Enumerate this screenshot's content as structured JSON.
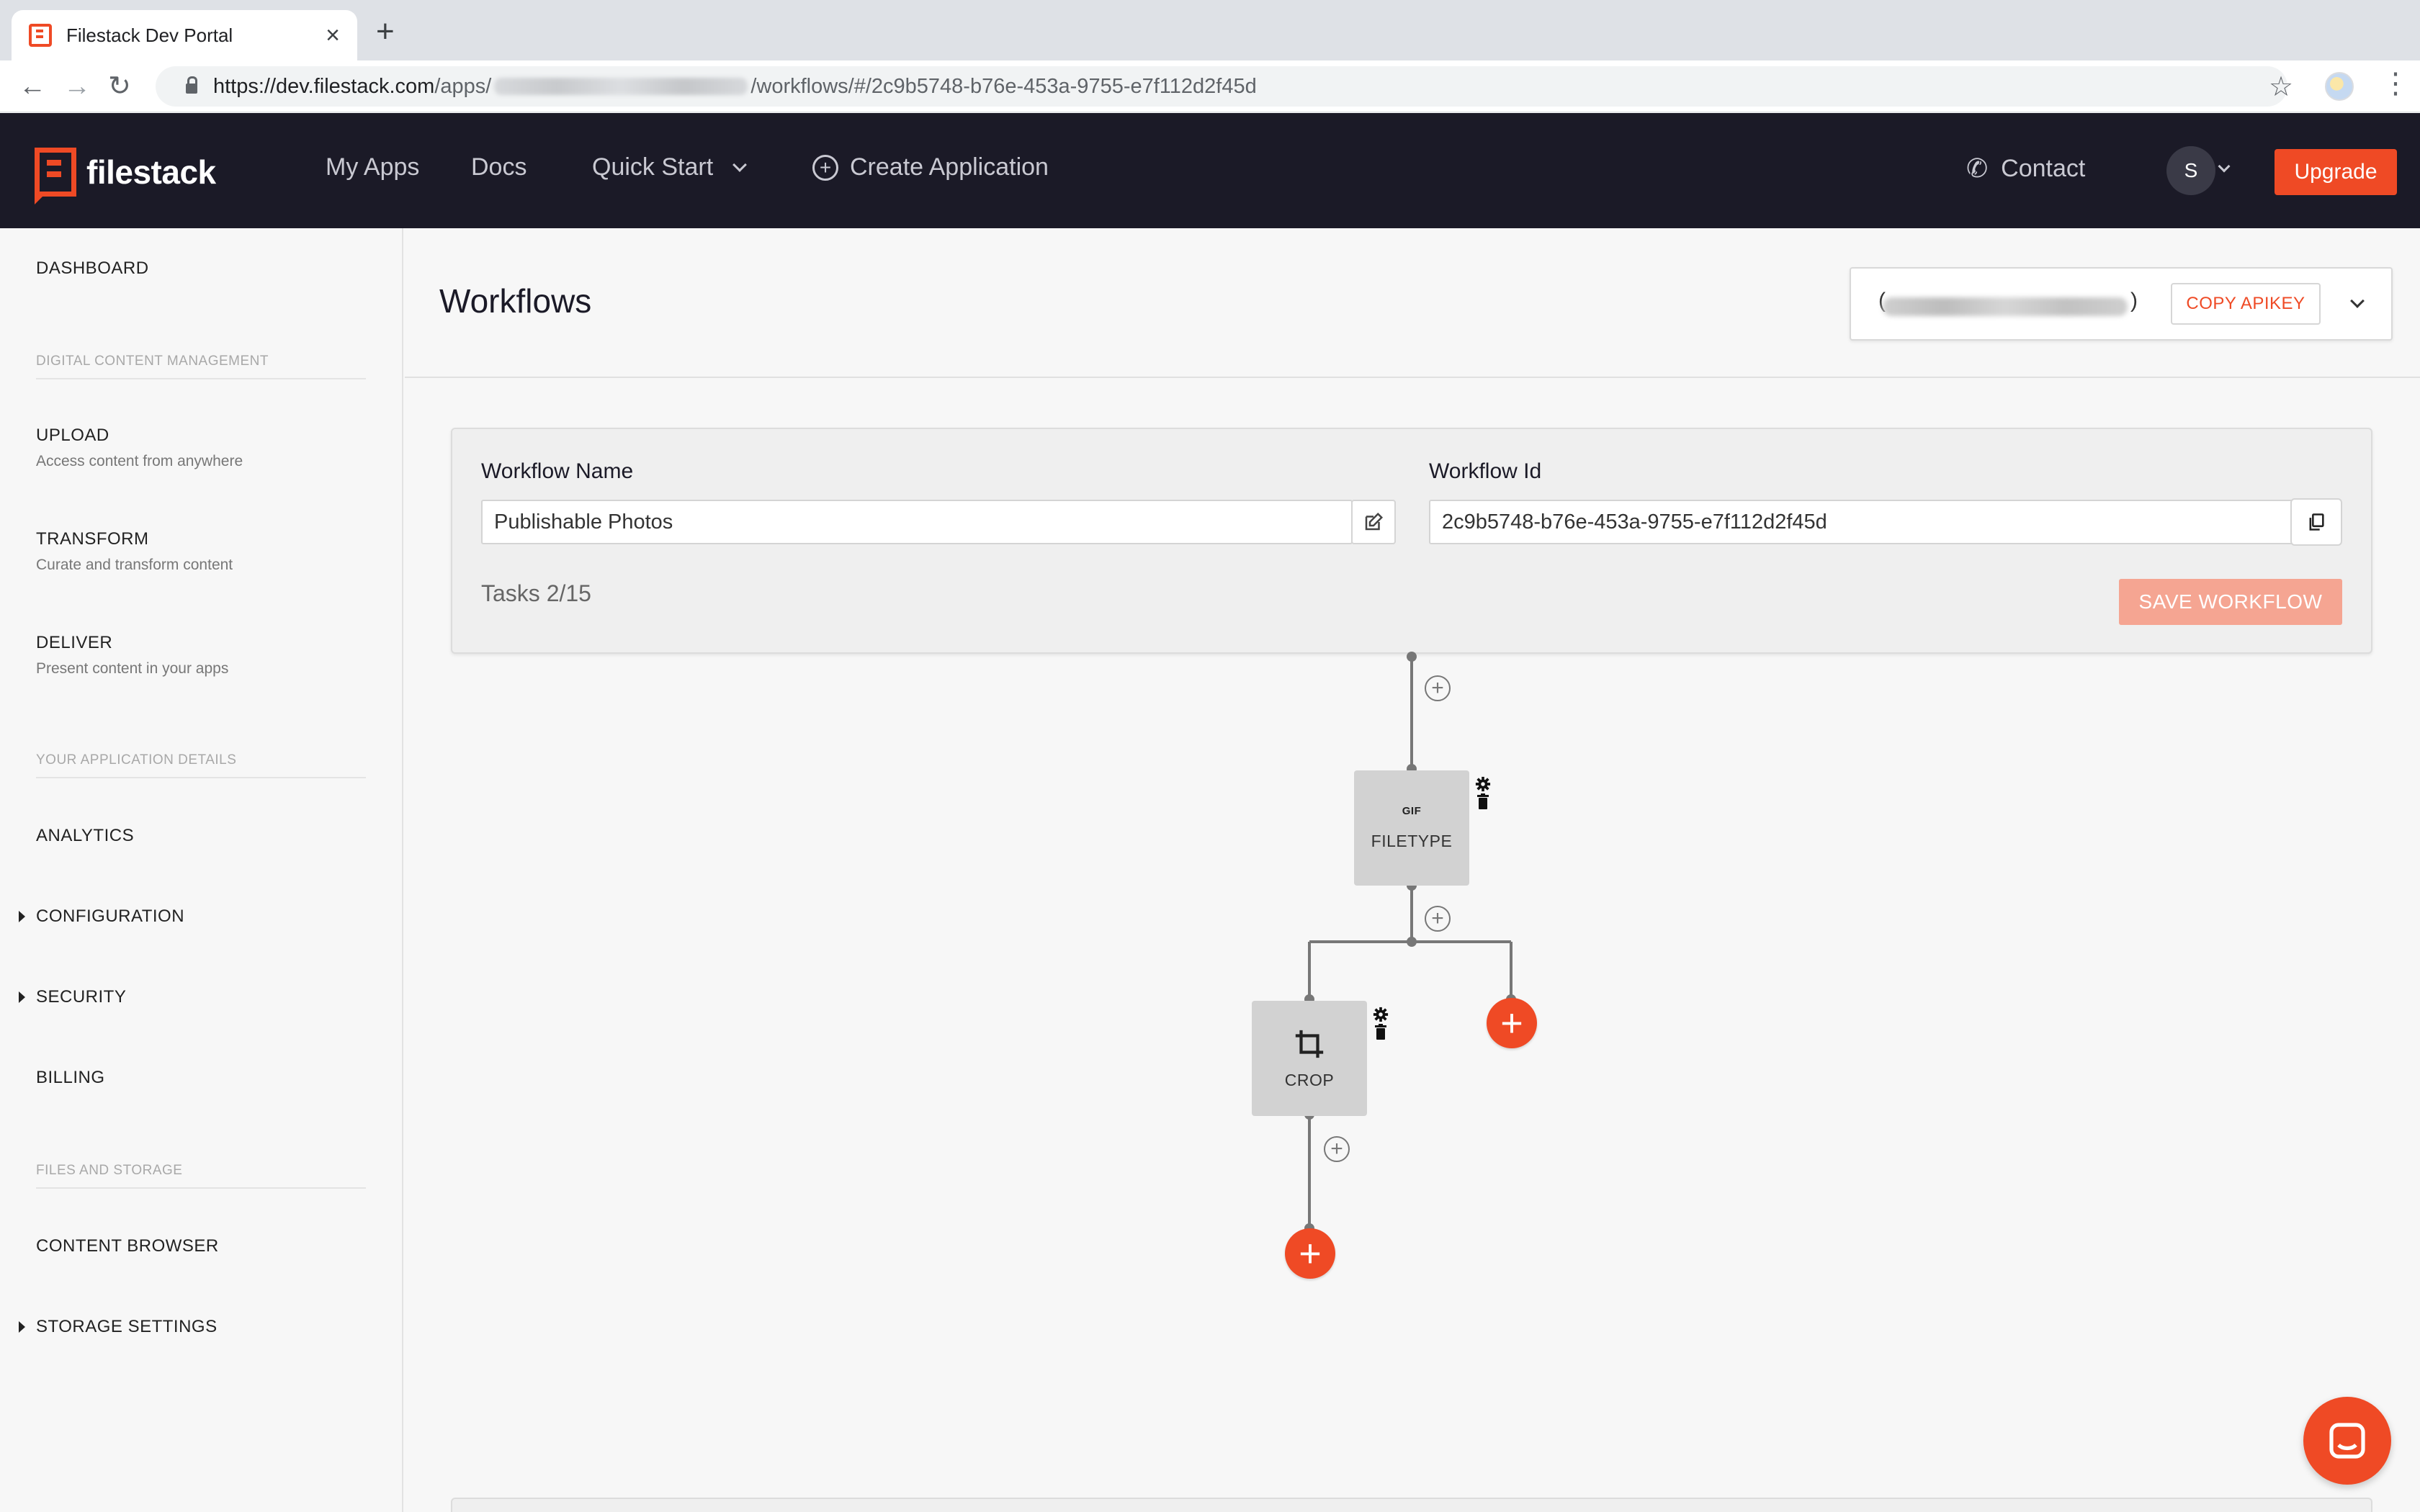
{
  "browser": {
    "tab_title": "Filestack Dev Portal",
    "tab_close": "×",
    "new_tab": "+",
    "url_host": "https://dev.filestack.com",
    "url_apps": "/apps/",
    "url_rest": "/workflows/#/2c9b5748-b76e-453a-9755-e7f112d2f45d",
    "back": "←",
    "forward": "→",
    "reload": "↻",
    "star": "☆",
    "menu": "⋮"
  },
  "header": {
    "logo_text": "filestack",
    "nav": {
      "my_apps": "My Apps",
      "docs": "Docs",
      "quick_start": "Quick Start",
      "create_application": "Create Application"
    },
    "contact": "Contact",
    "avatar_initial": "S",
    "upgrade": "Upgrade"
  },
  "sidebar": {
    "dashboard": "DASHBOARD",
    "section_dcm": "DIGITAL CONTENT MANAGEMENT",
    "upload": {
      "label": "UPLOAD",
      "desc": "Access content from anywhere"
    },
    "transform": {
      "label": "TRANSFORM",
      "desc": "Curate and transform content"
    },
    "deliver": {
      "label": "DELIVER",
      "desc": "Present content in your apps"
    },
    "section_app": "YOUR APPLICATION DETAILS",
    "analytics": "ANALYTICS",
    "configuration": "CONFIGURATION",
    "security": "SECURITY",
    "billing": "BILLING",
    "section_files": "FILES AND STORAGE",
    "content_browser": "CONTENT BROWSER",
    "storage_settings": "STORAGE SETTINGS"
  },
  "main": {
    "page_title": "Workflows",
    "apikey": {
      "open_paren": "(",
      "close_paren": ")",
      "copy_label": "COPY APIKEY"
    },
    "workflow": {
      "name_label": "Workflow Name",
      "name_value": "Publishable Photos",
      "id_label": "Workflow Id",
      "id_value": "2c9b5748-b76e-453a-9755-e7f112d2f45d",
      "tasks": "Tasks 2/15",
      "save_label": "SAVE WORKFLOW"
    },
    "graph": {
      "filetype_label": "FILETYPE",
      "filetype_glyph": "GIF",
      "crop_label": "CROP",
      "plus": "+"
    }
  },
  "colors": {
    "brand": "#ef4a25",
    "header_bg": "#1b1a27",
    "save_disabled": "#f5a592",
    "node_bg": "#d2d2d2"
  }
}
